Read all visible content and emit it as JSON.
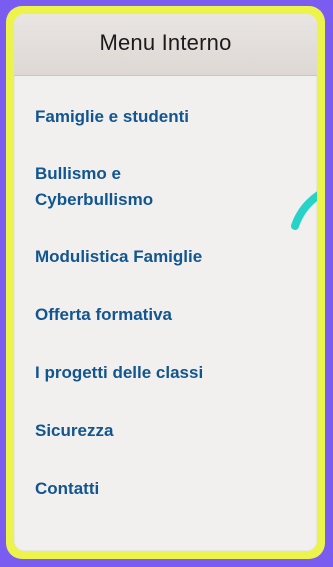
{
  "panel": {
    "title": "Menu Interno"
  },
  "menu": {
    "items": [
      {
        "label": "Famiglie e studenti"
      },
      {
        "label": "Bullismo e\nCyberbullismo"
      },
      {
        "label": "Modulistica Famiglie"
      },
      {
        "label": "Offerta formativa"
      },
      {
        "label": "I progetti delle classi"
      },
      {
        "label": "Sicurezza"
      },
      {
        "label": "Contatti"
      }
    ]
  },
  "colors": {
    "background": "#7B5CF0",
    "frame": "#ECF34A",
    "panel": "#F1F0EF",
    "header": "#E3DEDA",
    "link": "#12558F",
    "stroke": "#27D3C6"
  }
}
